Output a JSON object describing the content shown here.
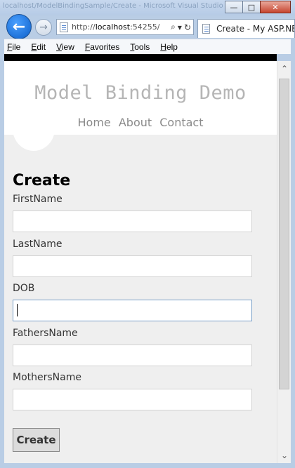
{
  "window": {
    "title_ghost": "localhost/ModelBindingSample/Create - Microsoft Visual Studio",
    "minimize_glyph": "—",
    "maximize_glyph": "□",
    "close_glyph": "✕"
  },
  "browser": {
    "back_glyph": "←",
    "forward_glyph": "→",
    "url_prefix": "http://",
    "url_host": "localhost",
    "url_rest": ":54255/",
    "search_glyph": "⌕",
    "dropdown_glyph": "▾",
    "refresh_glyph": "↻",
    "tab_title": "Create - My ASP.NET"
  },
  "menu": [
    "File",
    "Edit",
    "View",
    "Favorites",
    "Tools",
    "Help"
  ],
  "site": {
    "title": "Model Binding Demo",
    "nav": [
      "Home",
      "About",
      "Contact"
    ]
  },
  "form": {
    "heading": "Create",
    "fields": [
      {
        "label": "FirstName",
        "value": ""
      },
      {
        "label": "LastName",
        "value": ""
      },
      {
        "label": "DOB",
        "value": ""
      },
      {
        "label": "FathersName",
        "value": ""
      },
      {
        "label": "MothersName",
        "value": ""
      }
    ],
    "submit_label": "Create"
  },
  "scrollbar": {
    "up_glyph": "⌃",
    "down_glyph": "⌄"
  }
}
